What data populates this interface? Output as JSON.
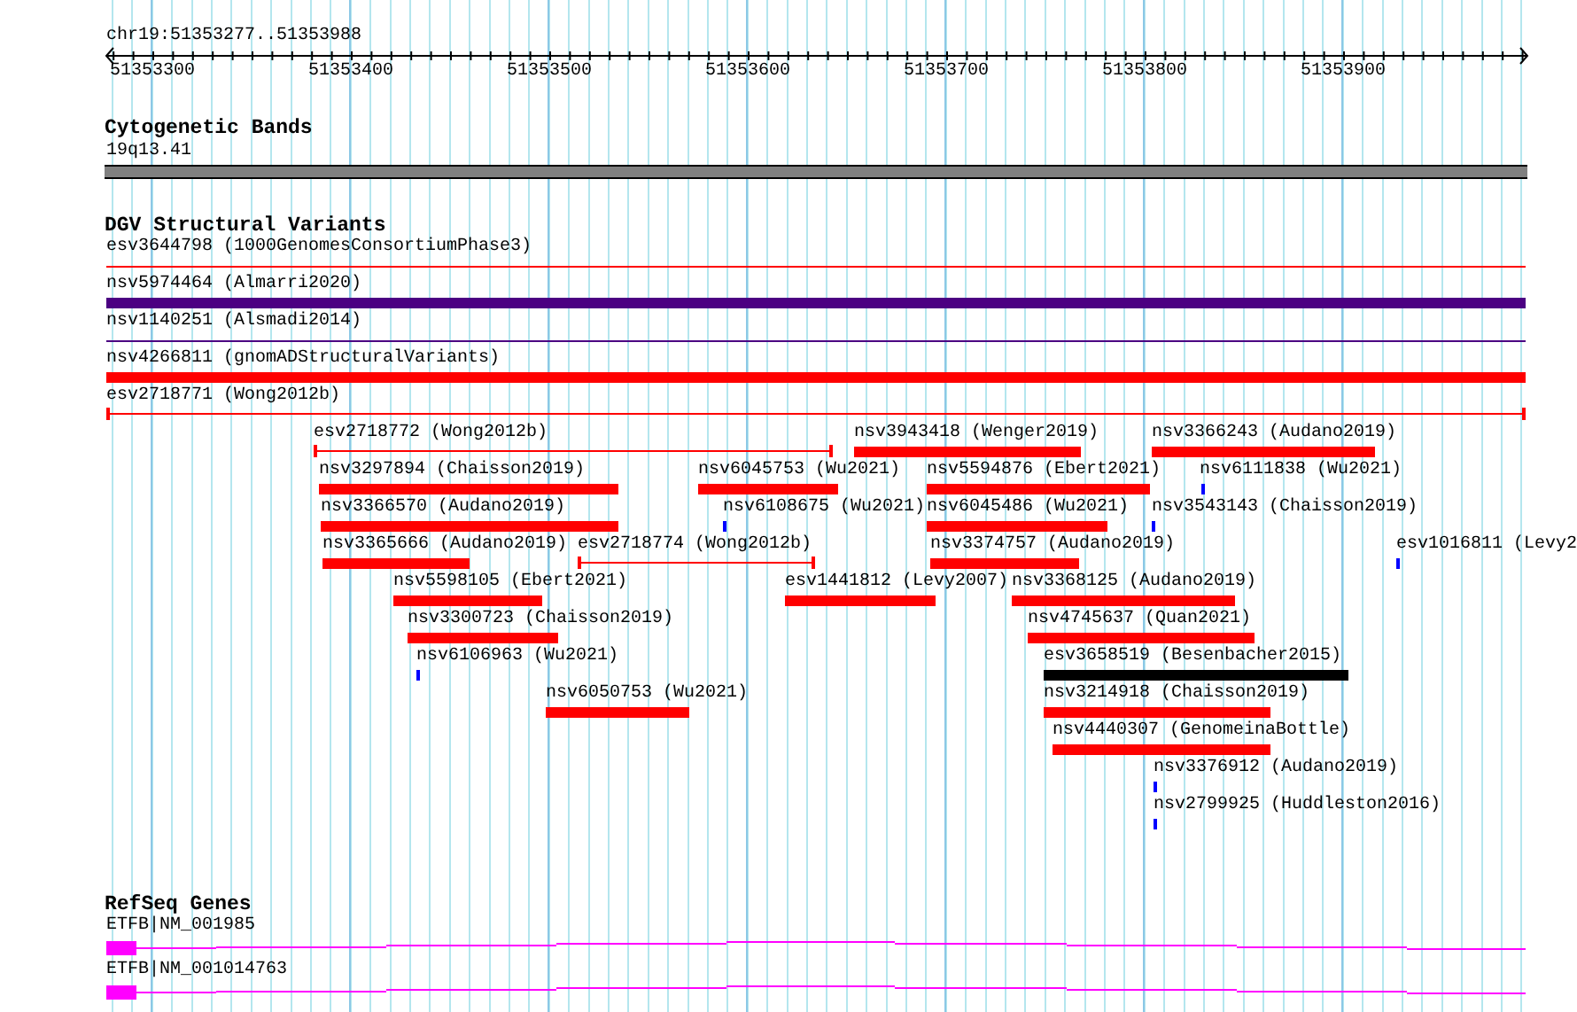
{
  "location": "chr19:51353277..51353988",
  "ruler": {
    "tick_labels": [
      "51353300",
      "51353400",
      "51353500",
      "51353600",
      "51353700",
      "51353800",
      "51353900"
    ]
  },
  "tracks": [
    {
      "kind": "cytobands",
      "title": "Cytogenetic Bands",
      "features": [
        {
          "label": "19q13.41"
        }
      ]
    },
    {
      "kind": "variants",
      "title": "DGV Structural Variants",
      "features": [
        {
          "label": "esv3644798 (1000GenomesConsortiumPhase3)",
          "kind": "line",
          "color": "#ff0000"
        },
        {
          "label": "nsv5974464 (Almarri2020)",
          "kind": "bar",
          "color": "#4b0082"
        },
        {
          "label": "nsv1140251 (Alsmadi2014)",
          "kind": "line",
          "color": "#4b0082"
        },
        {
          "label": "nsv4266811 (gnomADStructuralVariants)",
          "kind": "bar",
          "color": "#ff0000"
        },
        {
          "label": "esv2718771 (Wong2012b)",
          "kind": "interval",
          "color": "#ff0000"
        },
        {
          "label": "esv2718772 (Wong2012b)",
          "kind": "interval",
          "color": "#ff0000"
        },
        {
          "label": "nsv3943418 (Wenger2019)",
          "kind": "bar",
          "color": "#ff0000"
        },
        {
          "label": "nsv3366243 (Audano2019)",
          "kind": "bar",
          "color": "#ff0000"
        },
        {
          "label": "nsv3297894 (Chaisson2019)",
          "kind": "bar",
          "color": "#ff0000"
        },
        {
          "label": "nsv6045753 (Wu2021)",
          "kind": "bar",
          "color": "#ff0000"
        },
        {
          "label": "nsv5594876 (Ebert2021)",
          "kind": "bar",
          "color": "#ff0000"
        },
        {
          "label": "nsv6111838 (Wu2021)",
          "kind": "point",
          "color": "#0000ff"
        },
        {
          "label": "nsv3366570 (Audano2019)",
          "kind": "bar",
          "color": "#ff0000"
        },
        {
          "label": "nsv6108675 (Wu2021)",
          "kind": "point",
          "color": "#0000ff"
        },
        {
          "label": "nsv6045486 (Wu2021)",
          "kind": "bar",
          "color": "#ff0000"
        },
        {
          "label": "nsv3543143 (Chaisson2019)",
          "kind": "point",
          "color": "#0000ff"
        },
        {
          "label": "nsv3365666 (Audano2019)",
          "kind": "bar",
          "color": "#ff0000"
        },
        {
          "label": "esv2718774 (Wong2012b)",
          "kind": "interval",
          "color": "#ff0000"
        },
        {
          "label": "nsv3374757 (Audano2019)",
          "kind": "bar",
          "color": "#ff0000"
        },
        {
          "label": "esv1016811 (Levy2",
          "kind": "point",
          "color": "#0000ff"
        },
        {
          "label": "nsv5598105 (Ebert2021)",
          "kind": "bar",
          "color": "#ff0000"
        },
        {
          "label": "esv1441812 (Levy2007)",
          "kind": "bar",
          "color": "#ff0000"
        },
        {
          "label": "nsv3368125 (Audano2019)",
          "kind": "bar",
          "color": "#ff0000"
        },
        {
          "label": "nsv3300723 (Chaisson2019)",
          "kind": "bar",
          "color": "#ff0000"
        },
        {
          "label": "nsv4745637 (Quan2021)",
          "kind": "bar",
          "color": "#ff0000"
        },
        {
          "label": "nsv6106963 (Wu2021)",
          "kind": "point",
          "color": "#0000ff"
        },
        {
          "label": "esv3658519 (Besenbacher2015)",
          "kind": "bar",
          "color": "#000000"
        },
        {
          "label": "nsv6050753 (Wu2021)",
          "kind": "bar",
          "color": "#ff0000"
        },
        {
          "label": "nsv3214918 (Chaisson2019)",
          "kind": "bar",
          "color": "#ff0000"
        },
        {
          "label": "nsv4440307 (GenomeinaBottle)",
          "kind": "bar",
          "color": "#ff0000"
        },
        {
          "label": "nsv3376912 (Audano2019)",
          "kind": "point",
          "color": "#0000ff"
        },
        {
          "label": "nsv2799925 (Huddleston2016)",
          "kind": "point",
          "color": "#0000ff"
        }
      ]
    },
    {
      "kind": "genes",
      "title": "RefSeq Genes",
      "features": [
        {
          "label": "ETFB|NM_001985"
        },
        {
          "label": "ETFB|NM_001014763"
        }
      ]
    }
  ]
}
